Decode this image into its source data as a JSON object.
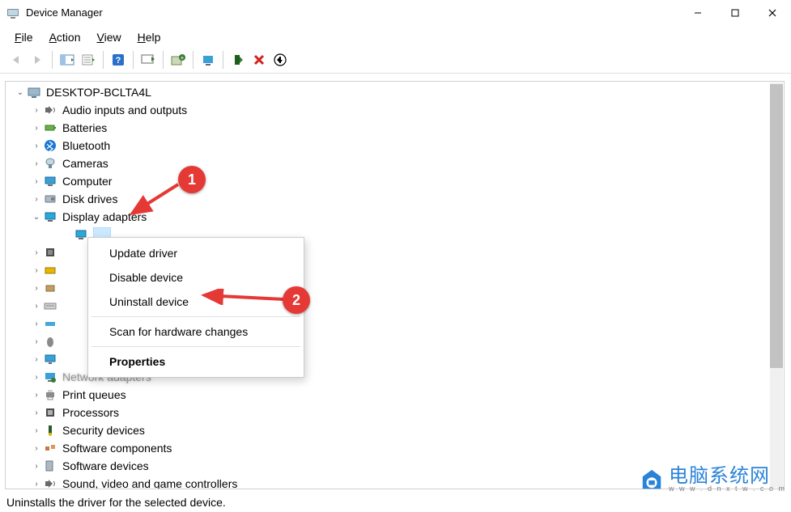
{
  "window": {
    "title": "Device Manager"
  },
  "menubar": {
    "file": {
      "label": "File",
      "accel_index": 0
    },
    "action": {
      "label": "Action",
      "accel_index": 0
    },
    "view": {
      "label": "View",
      "accel_index": 0
    },
    "help": {
      "label": "Help",
      "accel_index": 0
    }
  },
  "toolbar": {
    "back": "Back",
    "forward": "Forward",
    "show_tree": "Show/Hide console tree",
    "properties": "Properties",
    "help": "Help",
    "update": "Update driver",
    "install_legacy": "Add legacy hardware",
    "scan": "Scan for hardware changes",
    "enable": "Enable device",
    "uninstall": "Uninstall device",
    "add": "Add drivers"
  },
  "tree": {
    "root": {
      "label": "DESKTOP-BCLTA4L",
      "expanded": true
    },
    "items": [
      {
        "label": "Audio inputs and outputs",
        "icon": "speaker",
        "collapsed": true
      },
      {
        "label": "Batteries",
        "icon": "battery",
        "collapsed": true
      },
      {
        "label": "Bluetooth",
        "icon": "bluetooth",
        "collapsed": true
      },
      {
        "label": "Cameras",
        "icon": "camera",
        "collapsed": true
      },
      {
        "label": "Computer",
        "icon": "computer",
        "collapsed": true
      },
      {
        "label": "Disk drives",
        "icon": "disk",
        "collapsed": true
      },
      {
        "label": "Display adapters",
        "icon": "display",
        "expanded": true,
        "selected_child": true
      },
      {
        "label": "",
        "icon": "chip",
        "collapsed": true,
        "blur": true
      },
      {
        "label": "",
        "icon": "hid",
        "collapsed": true,
        "blur": true
      },
      {
        "label": "",
        "icon": "imaging",
        "collapsed": true,
        "blur": true
      },
      {
        "label": "",
        "icon": "keyboard",
        "collapsed": true,
        "blur": true
      },
      {
        "label": "",
        "icon": "storage",
        "collapsed": true,
        "blur": true
      },
      {
        "label": "",
        "icon": "mouse",
        "collapsed": true,
        "blur": true
      },
      {
        "label": "",
        "icon": "monitor",
        "collapsed": true,
        "blur": true
      },
      {
        "label": "Network adapters",
        "icon": "network",
        "collapsed": true,
        "blur": true
      },
      {
        "label": "Print queues",
        "icon": "printer",
        "collapsed": true
      },
      {
        "label": "Processors",
        "icon": "cpu",
        "collapsed": true
      },
      {
        "label": "Security devices",
        "icon": "security",
        "collapsed": true
      },
      {
        "label": "Software components",
        "icon": "component",
        "collapsed": true
      },
      {
        "label": "Software devices",
        "icon": "softdevice",
        "collapsed": true
      },
      {
        "label": "Sound, video and game controllers",
        "icon": "sound",
        "collapsed": true
      }
    ]
  },
  "context_menu": {
    "items": [
      {
        "label": "Update driver"
      },
      {
        "label": "Disable device"
      },
      {
        "label": "Uninstall device"
      },
      {
        "sep": true
      },
      {
        "label": "Scan for hardware changes"
      },
      {
        "sep": true
      },
      {
        "label": "Properties",
        "bold": true
      }
    ]
  },
  "statusbar": {
    "text": "Uninstalls the driver for the selected device."
  },
  "annotations": {
    "a1": "1",
    "a2": "2"
  },
  "watermark": {
    "text": "电脑系统网",
    "sub": "w w w . d n x t w . c o m"
  }
}
